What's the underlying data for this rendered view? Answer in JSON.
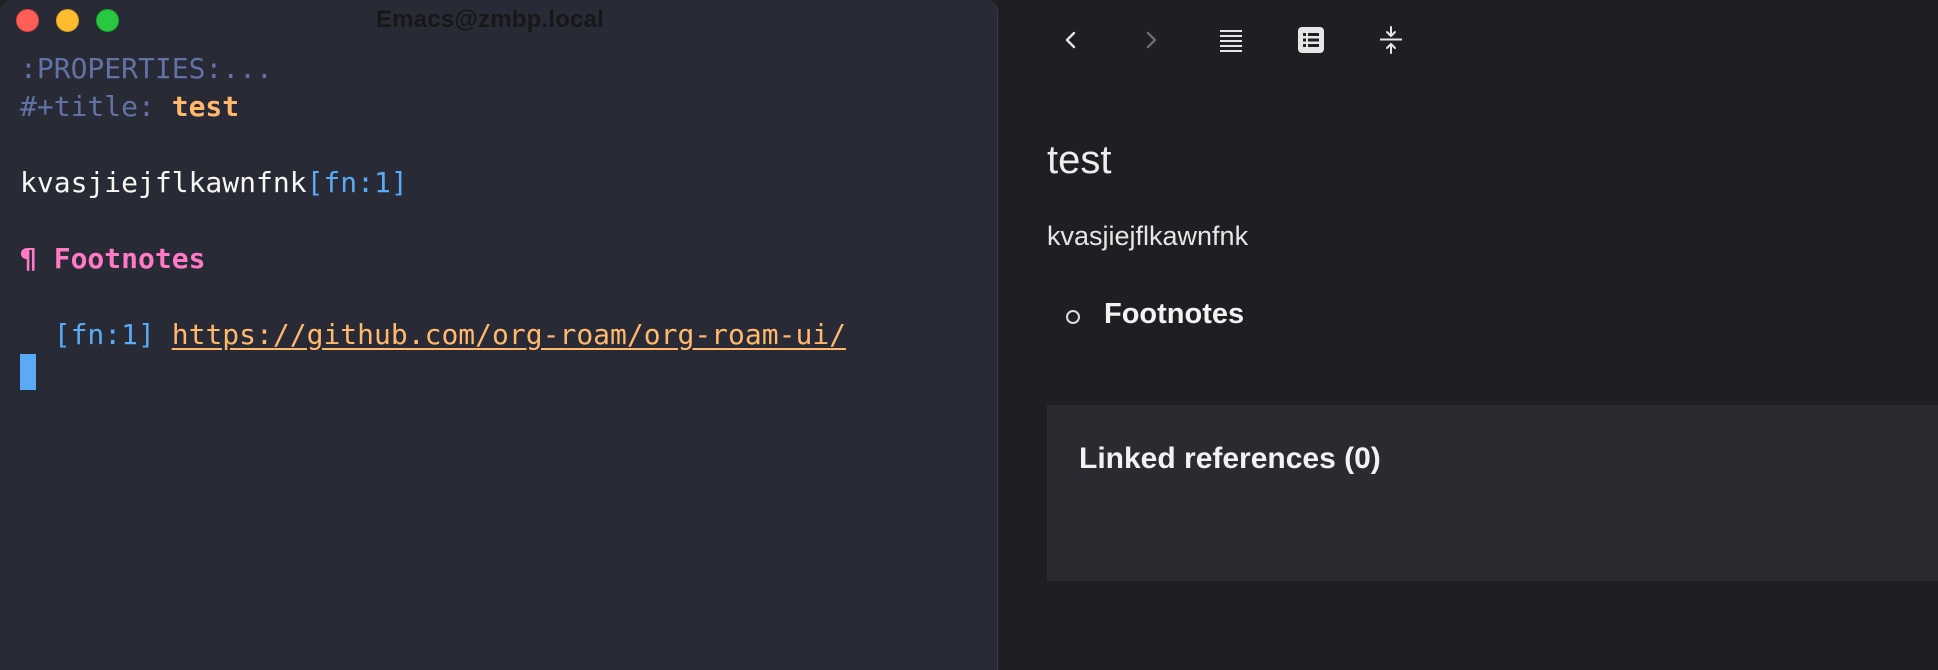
{
  "window": {
    "title": "Emacs@zmbp.local"
  },
  "editor": {
    "properties_drawer": ":PROPERTIES:...",
    "title_keyword": "#+title:",
    "title_value": "test",
    "body_text": "kvasjiejflkawnfnk",
    "footnote_ref": "[fn:1]",
    "heading_marker": "¶",
    "heading_text": "Footnotes",
    "footnote_label": "[fn:1]",
    "footnote_link": "https://github.com/org-roam/org-roam-ui/"
  },
  "preview": {
    "toolbar": [
      {
        "name": "back-icon",
        "state": "enabled"
      },
      {
        "name": "forward-icon",
        "state": "disabled"
      },
      {
        "name": "justify-text-icon",
        "state": "enabled"
      },
      {
        "name": "outline-list-icon",
        "state": "enabled"
      },
      {
        "name": "collapse-icon",
        "state": "enabled"
      }
    ],
    "note_title": "test",
    "note_body": "kvasjiejflkawnfnk",
    "footnotes_heading": "Footnotes",
    "backlinks_title": "Linked references (0)"
  },
  "colors": {
    "editor_bg": "#282a36",
    "preview_bg": "#1f1f23",
    "meta": "#6272a4",
    "title": "#ffb86c",
    "footnote": "#5aaaf5",
    "heading": "#ff79c6",
    "link": "#ffb86c"
  }
}
